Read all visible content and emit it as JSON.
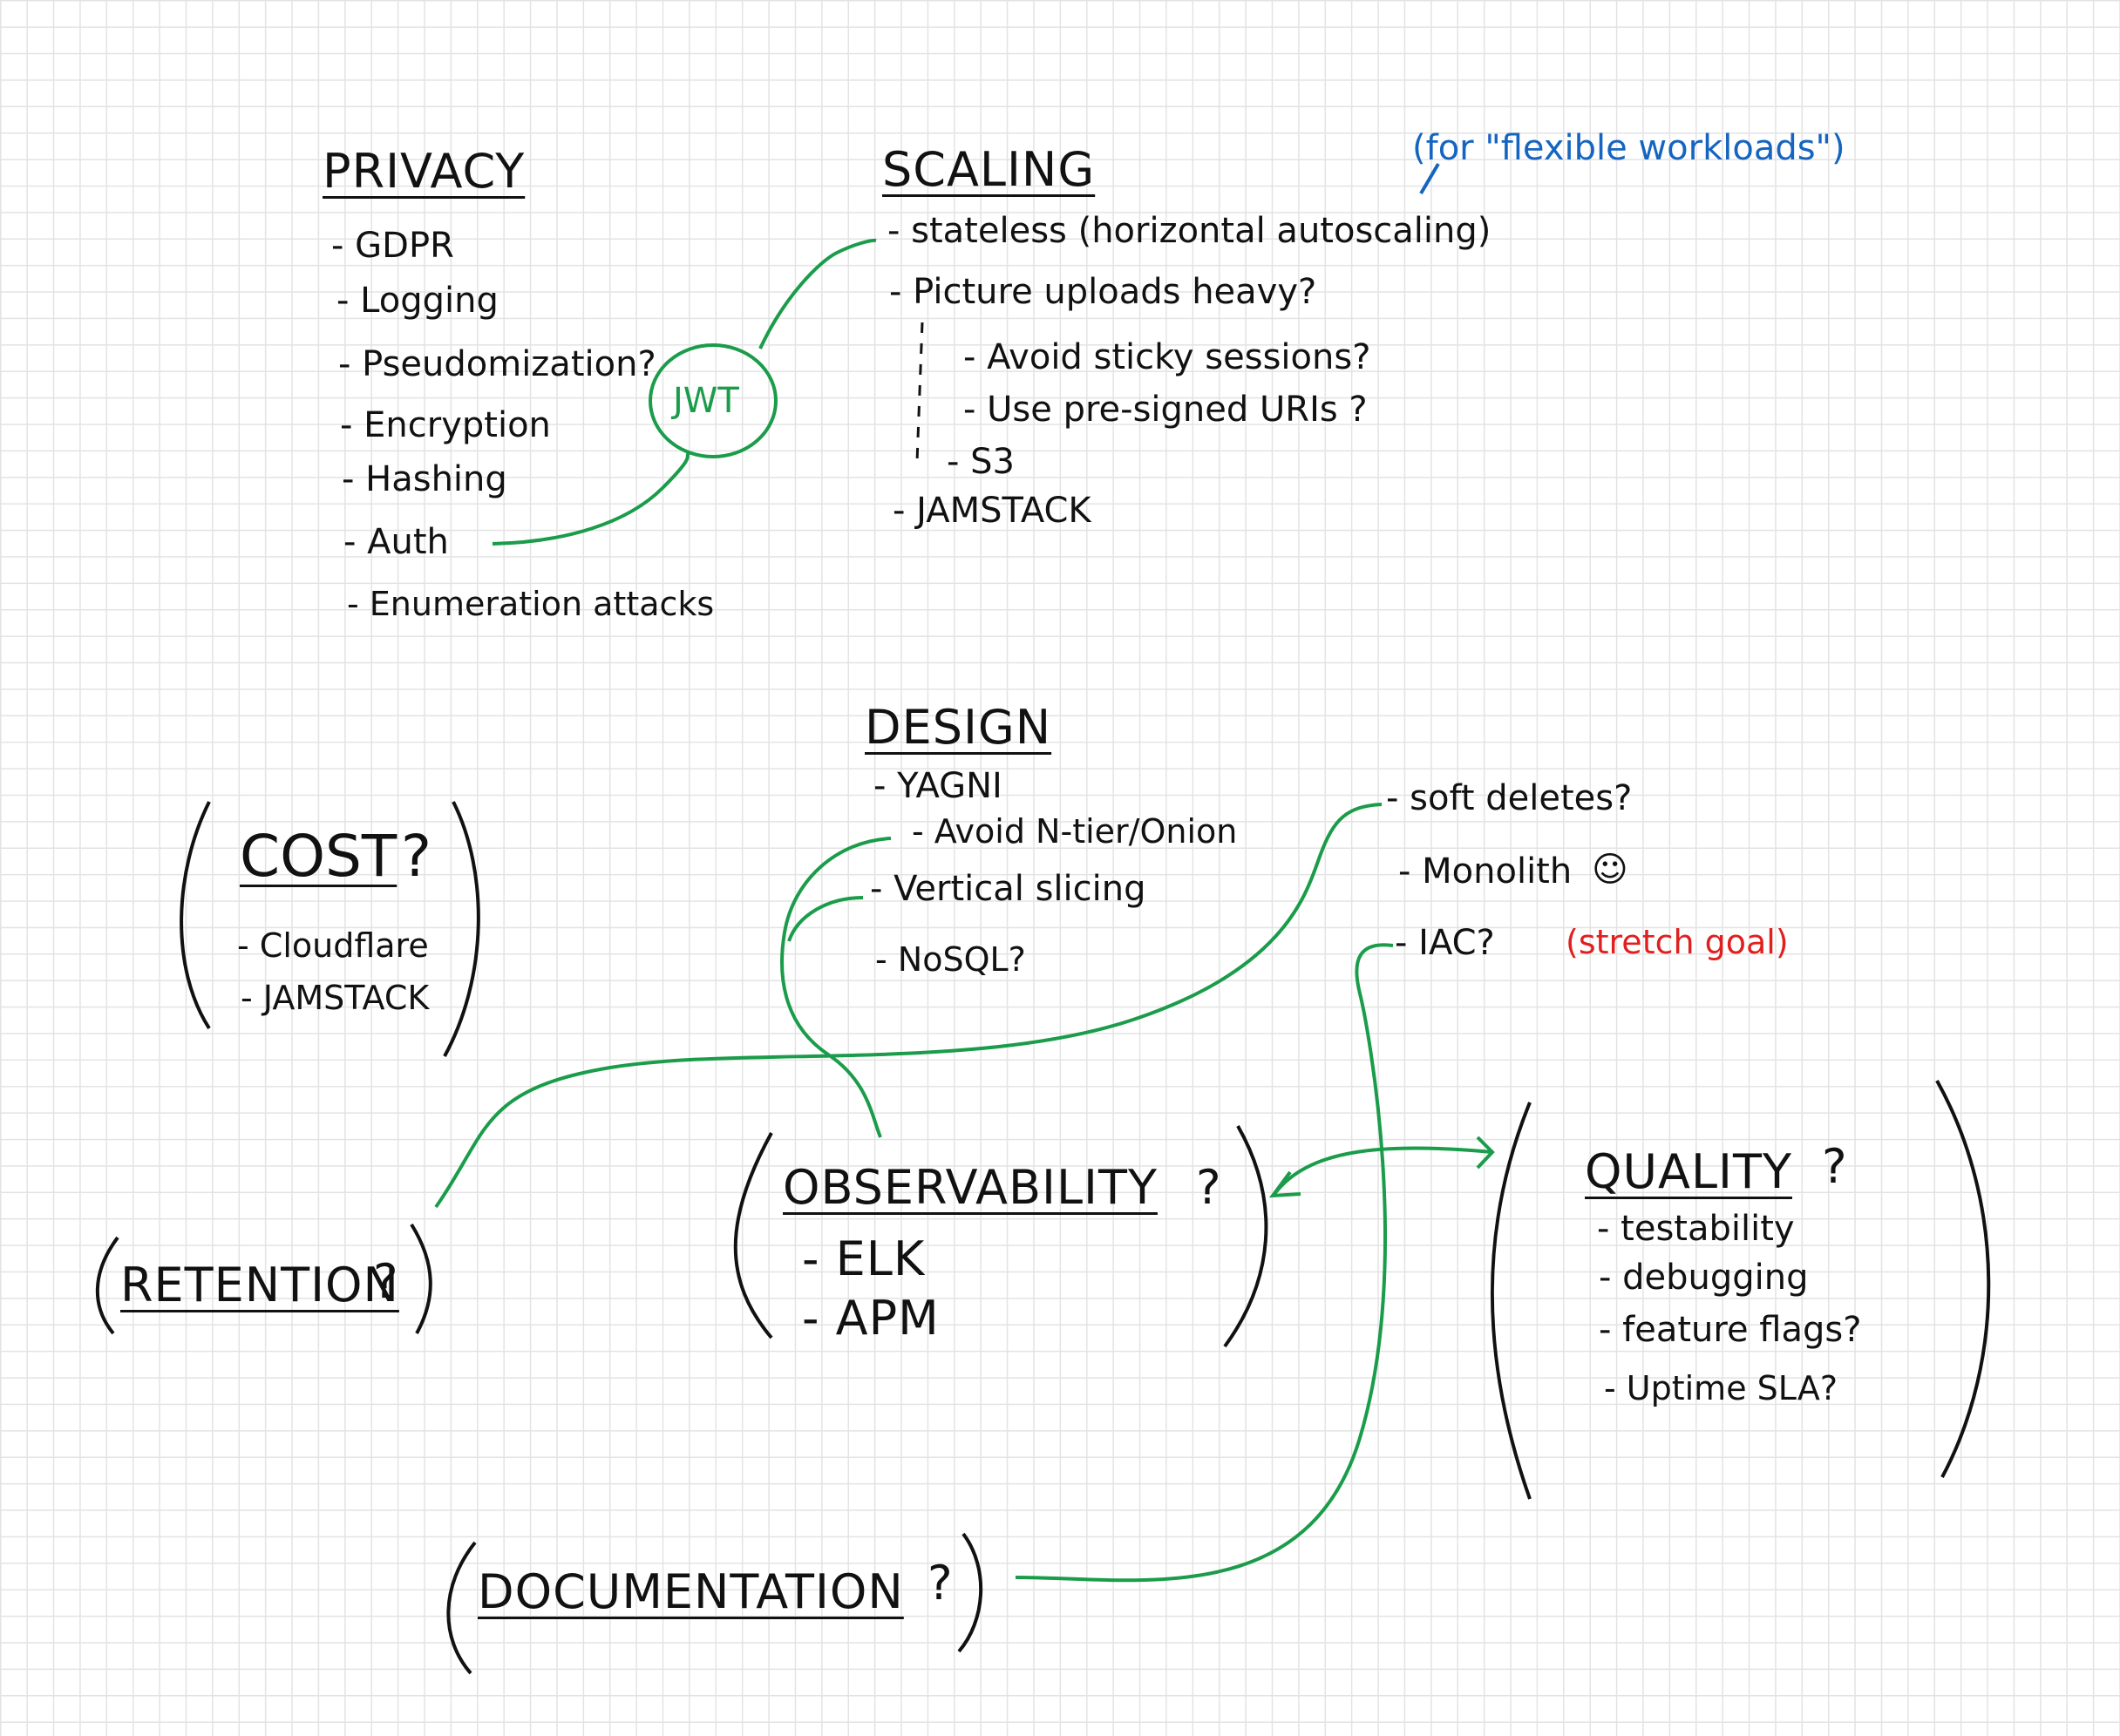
{
  "notes": {
    "privacy": {
      "title": "PRIVACY",
      "items": [
        "- GDPR",
        "- Logging",
        "- Pseudomization?",
        "- Encryption",
        "- Hashing",
        "- Auth",
        "- Enumeration attacks"
      ]
    },
    "jwt": "JWT",
    "scaling": {
      "title": "SCALING",
      "annotation": "(for \"flexible workloads\")",
      "items": [
        "- stateless (horizontal autoscaling)",
        "- Picture uploads heavy?",
        "- JAMSTACK"
      ],
      "subitems": [
        "- Avoid sticky sessions?",
        "- Use pre-signed URIs ?",
        "- S3"
      ]
    },
    "design": {
      "title": "DESIGN",
      "items": [
        "- YAGNI",
        "- Vertical slicing",
        "- NoSQL?"
      ],
      "subitems": [
        "- Avoid N-tier/Onion"
      ]
    },
    "design_right": {
      "items": [
        "- soft deletes?",
        "- Monolith",
        "- IAC?"
      ],
      "smiley": "☺",
      "stretch": "(stretch goal)"
    },
    "cost": {
      "title": "COST",
      "q": "?",
      "items": [
        "- Cloudflare",
        "- JAMSTACK"
      ]
    },
    "retention": {
      "title": "RETENTION",
      "q": "?"
    },
    "observability": {
      "title": "OBSERVABILITY",
      "q": "?",
      "items": [
        "- ELK",
        "- APM"
      ]
    },
    "quality": {
      "title": "QUALITY",
      "q": "?",
      "items": [
        "- testability",
        "- debugging",
        "- feature flags?",
        "- Uptime SLA?"
      ]
    },
    "documentation": {
      "title": "DOCUMENTATION",
      "q": "?"
    }
  },
  "colors": {
    "ink": "#111111",
    "connector": "#1a9c4a",
    "annotation": "#1565c0",
    "stretch": "#e02020",
    "grid": "#e3e3e3"
  }
}
